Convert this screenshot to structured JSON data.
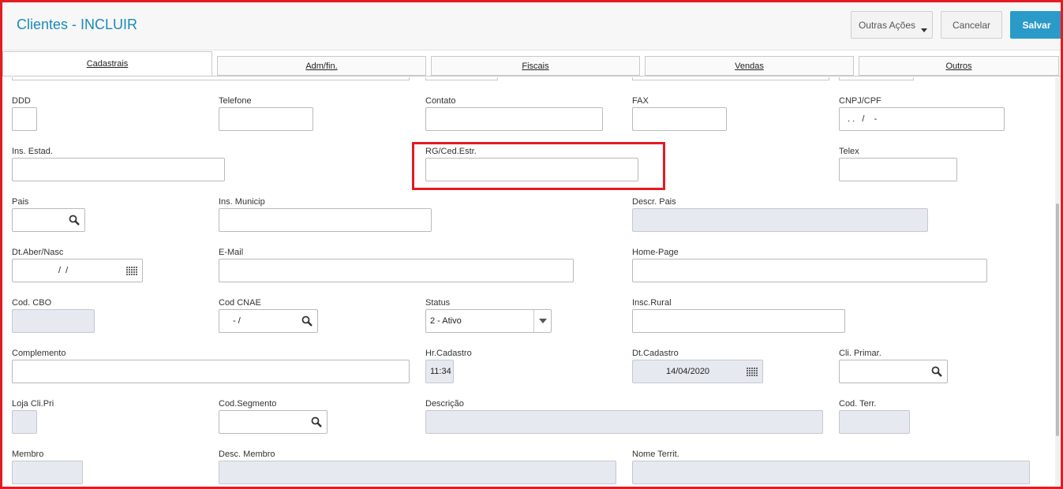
{
  "header": {
    "title": "Clientes - INCLUIR",
    "buttons": {
      "outras": "Outras Ações",
      "cancelar": "Cancelar",
      "salvar": "Salvar"
    }
  },
  "tabs": [
    "Cadastrais",
    "Adm/fin.",
    "Fiscais",
    "Vendas",
    "Outros"
  ],
  "fields": {
    "ddd": {
      "label": "DDD",
      "value": ""
    },
    "telefone": {
      "label": "Telefone",
      "value": ""
    },
    "contato": {
      "label": "Contato",
      "value": ""
    },
    "fax": {
      "label": "FAX",
      "value": ""
    },
    "cnpj": {
      "label": "CNPJ/CPF",
      "value": ". .   /    -"
    },
    "ins_estad": {
      "label": "Ins. Estad.",
      "value": ""
    },
    "rg": {
      "label": "RG/Ced.Estr.",
      "value": ""
    },
    "telex": {
      "label": "Telex",
      "value": ""
    },
    "pais": {
      "label": "Pais",
      "value": ""
    },
    "ins_municip": {
      "label": "Ins. Municip",
      "value": ""
    },
    "descr_pais": {
      "label": "Descr. Pais",
      "value": ""
    },
    "dt_aber": {
      "label": "Dt.Aber/Nasc",
      "value": "/  /"
    },
    "email": {
      "label": "E-Mail",
      "value": ""
    },
    "home_page": {
      "label": "Home-Page",
      "value": ""
    },
    "cod_cbo": {
      "label": "Cod. CBO",
      "value": ""
    },
    "cod_cnae": {
      "label": "Cod CNAE",
      "value": "- /"
    },
    "status": {
      "label": "Status",
      "value": "2 - Ativo"
    },
    "insc_rural": {
      "label": "Insc.Rural",
      "value": ""
    },
    "complemento": {
      "label": "Complemento",
      "value": ""
    },
    "hr_cadastro": {
      "label": "Hr.Cadastro",
      "value": "11:34"
    },
    "dt_cadastro": {
      "label": "Dt.Cadastro",
      "value": "14/04/2020"
    },
    "cli_primar": {
      "label": "Cli. Primar.",
      "value": ""
    },
    "loja_cli_pri": {
      "label": "Loja Cli.Pri",
      "value": ""
    },
    "cod_segmento": {
      "label": "Cod.Segmento",
      "value": ""
    },
    "descricao": {
      "label": "Descrição",
      "value": ""
    },
    "cod_terr": {
      "label": "Cod. Terr.",
      "value": ""
    },
    "membro": {
      "label": "Membro",
      "value": ""
    },
    "desc_membro": {
      "label": "Desc. Membro",
      "value": ""
    },
    "nome_territ": {
      "label": "Nome Territ.",
      "value": ""
    }
  },
  "icons": {
    "search": "search-icon",
    "calendar": "calendar-icon",
    "dropdown": "chevron-down-icon"
  },
  "colors": {
    "accent": "#1a8bb8",
    "save": "#2a9ac9",
    "highlight": "#e31b23",
    "readonly": "#e6e9ef"
  }
}
